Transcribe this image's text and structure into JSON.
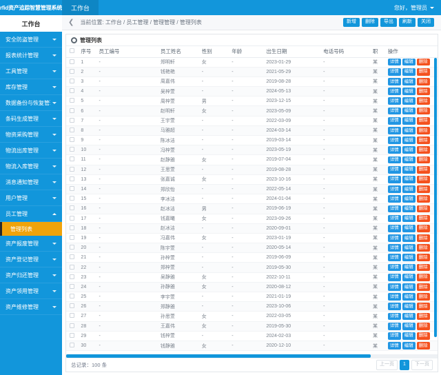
{
  "app": {
    "logo_text": "rfid资产追踪智慧管理系统",
    "accent": "#1296db",
    "highlight": "#f0a30a",
    "danger": "#f4511e"
  },
  "topnav": {
    "items": [
      {
        "label": "工作台"
      }
    ],
    "user_greeting": "您好，管理员"
  },
  "sidebar": {
    "title": "工作台",
    "items": [
      {
        "label": "安全防盗管理"
      },
      {
        "label": "报表统计管理"
      },
      {
        "label": "工具管理"
      },
      {
        "label": "库存管理"
      },
      {
        "label": "数据备份与恢复管理"
      },
      {
        "label": "条码生成管理"
      },
      {
        "label": "物资采购管理"
      },
      {
        "label": "物流出库管理"
      },
      {
        "label": "物流入库管理"
      },
      {
        "label": "消息通知管理"
      },
      {
        "label": "用户管理"
      },
      {
        "label": "员工管理"
      },
      {
        "label": "资产报废管理"
      },
      {
        "label": "资产登记管理"
      },
      {
        "label": "资产归还管理"
      },
      {
        "label": "资产领用管理"
      },
      {
        "label": "资产维修管理"
      }
    ],
    "submenu_label": "管理列表"
  },
  "breadcrumb": {
    "collapse_icon": "chevron-left-icon",
    "text": "当前位置: 工作台 / 员工管理 / 管理管理 / 管理列表",
    "buttons": [
      {
        "label": "新增"
      },
      {
        "label": "删除"
      },
      {
        "label": "导出"
      },
      {
        "label": "刷新"
      },
      {
        "label": "关闭"
      }
    ]
  },
  "panel": {
    "title": "管理列表",
    "columns": [
      "序号",
      "员工编号",
      "员工姓名",
      "性别",
      "年龄",
      "出生日期",
      "电话号码",
      "职",
      "操作"
    ],
    "row_actions": [
      {
        "label": "详情",
        "kind": "detail"
      },
      {
        "label": "编辑",
        "kind": "edit"
      },
      {
        "label": "删除",
        "kind": "del"
      }
    ],
    "empty": "-",
    "rows": [
      {
        "idx": "1",
        "code": "-",
        "name": "郑明轩",
        "sex": "女",
        "age": "-",
        "birth": "2023-01-29",
        "phone": "-",
        "pos": "某"
      },
      {
        "idx": "2",
        "code": "-",
        "name": "钱艳艳",
        "sex": "-",
        "age": "-",
        "birth": "2021-05-29",
        "phone": "-",
        "pos": "某"
      },
      {
        "idx": "3",
        "code": "-",
        "name": "周嘉伟",
        "sex": "-",
        "age": "-",
        "birth": "2019-08-28",
        "phone": "-",
        "pos": "某"
      },
      {
        "idx": "4",
        "code": "-",
        "name": "吴梓萱",
        "sex": "-",
        "age": "-",
        "birth": "2024-05-13",
        "phone": "-",
        "pos": "某"
      },
      {
        "idx": "5",
        "code": "-",
        "name": "周梓萱",
        "sex": "男",
        "age": "-",
        "birth": "2023-12-15",
        "phone": "-",
        "pos": "某"
      },
      {
        "idx": "6",
        "code": "-",
        "name": "赵明轩",
        "sex": "女",
        "age": "-",
        "birth": "2023-05-09",
        "phone": "-",
        "pos": "某"
      },
      {
        "idx": "7",
        "code": "-",
        "name": "王宇萱",
        "sex": "-",
        "age": "-",
        "birth": "2022-03-09",
        "phone": "-",
        "pos": "某"
      },
      {
        "idx": "8",
        "code": "-",
        "name": "马雅超",
        "sex": "-",
        "age": "-",
        "birth": "2024-03-14",
        "phone": "-",
        "pos": "某"
      },
      {
        "idx": "9",
        "code": "-",
        "name": "陈冰洁",
        "sex": "-",
        "age": "-",
        "birth": "2019-03-14",
        "phone": "-",
        "pos": "某"
      },
      {
        "idx": "10",
        "code": "-",
        "name": "冯梓萱",
        "sex": "-",
        "age": "-",
        "birth": "2023-05-19",
        "phone": "-",
        "pos": "某"
      },
      {
        "idx": "11",
        "code": "-",
        "name": "赵静雅",
        "sex": "女",
        "age": "-",
        "birth": "2019-07-04",
        "phone": "-",
        "pos": "某"
      },
      {
        "idx": "12",
        "code": "-",
        "name": "王思萱",
        "sex": "-",
        "age": "-",
        "birth": "2019-08-28",
        "phone": "-",
        "pos": "某"
      },
      {
        "idx": "13",
        "code": "-",
        "name": "张嘉诚",
        "sex": "女",
        "age": "-",
        "birth": "2023-10-16",
        "phone": "-",
        "pos": "某"
      },
      {
        "idx": "14",
        "code": "-",
        "name": "郑欣怡",
        "sex": "-",
        "age": "-",
        "birth": "2022-05-14",
        "phone": "-",
        "pos": "某"
      },
      {
        "idx": "15",
        "code": "-",
        "name": "李冰洁",
        "sex": "-",
        "age": "-",
        "birth": "2024-01-04",
        "phone": "-",
        "pos": "某"
      },
      {
        "idx": "16",
        "code": "-",
        "name": "赵冰洁",
        "sex": "男",
        "age": "-",
        "birth": "2019-06-19",
        "phone": "-",
        "pos": "某"
      },
      {
        "idx": "17",
        "code": "-",
        "name": "钱嘉曦",
        "sex": "女",
        "age": "-",
        "birth": "2023-09-26",
        "phone": "-",
        "pos": "某"
      },
      {
        "idx": "18",
        "code": "-",
        "name": "赵冰洁",
        "sex": "-",
        "age": "-",
        "birth": "2020-09-01",
        "phone": "-",
        "pos": "某"
      },
      {
        "idx": "19",
        "code": "-",
        "name": "冯嘉伟",
        "sex": "女",
        "age": "-",
        "birth": "2023-01-19",
        "phone": "-",
        "pos": "某"
      },
      {
        "idx": "20",
        "code": "-",
        "name": "陈宇萱",
        "sex": "-",
        "age": "-",
        "birth": "2020-05-14",
        "phone": "-",
        "pos": "某"
      },
      {
        "idx": "21",
        "code": "-",
        "name": "孙梓萱",
        "sex": "-",
        "age": "-",
        "birth": "2019-06-09",
        "phone": "-",
        "pos": "某"
      },
      {
        "idx": "22",
        "code": "-",
        "name": "郑梓萱",
        "sex": "-",
        "age": "-",
        "birth": "2019-05-30",
        "phone": "-",
        "pos": "某"
      },
      {
        "idx": "23",
        "code": "-",
        "name": "吴静雅",
        "sex": "女",
        "age": "-",
        "birth": "2022-10-11",
        "phone": "-",
        "pos": "某"
      },
      {
        "idx": "24",
        "code": "-",
        "name": "孙静雅",
        "sex": "女",
        "age": "-",
        "birth": "2020-08-12",
        "phone": "-",
        "pos": "某"
      },
      {
        "idx": "25",
        "code": "-",
        "name": "李宇萱",
        "sex": "-",
        "age": "-",
        "birth": "2021-01-19",
        "phone": "-",
        "pos": "某"
      },
      {
        "idx": "26",
        "code": "-",
        "name": "郑静雅",
        "sex": "-",
        "age": "-",
        "birth": "2023-10-06",
        "phone": "-",
        "pos": "某"
      },
      {
        "idx": "27",
        "code": "-",
        "name": "孙思萱",
        "sex": "女",
        "age": "-",
        "birth": "2022-03-05",
        "phone": "-",
        "pos": "某"
      },
      {
        "idx": "28",
        "code": "-",
        "name": "王嘉伟",
        "sex": "女",
        "age": "-",
        "birth": "2019-05-30",
        "phone": "-",
        "pos": "某"
      },
      {
        "idx": "29",
        "code": "-",
        "name": "钱梓萱",
        "sex": "-",
        "age": "-",
        "birth": "2024-02-03",
        "phone": "-",
        "pos": "某"
      },
      {
        "idx": "30",
        "code": "-",
        "name": "钱静雅",
        "sex": "女",
        "age": "-",
        "birth": "2020-12-10",
        "phone": "-",
        "pos": "某"
      }
    ],
    "footer": {
      "total_text": "总记录：100 条",
      "prev_label": "上一页",
      "current_page": "1",
      "next_label": "下一页"
    }
  }
}
